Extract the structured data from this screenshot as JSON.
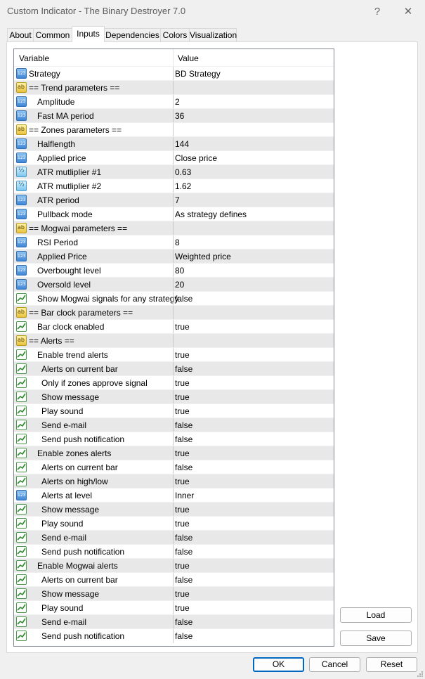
{
  "window": {
    "title": "Custom Indicator - The Binary Destroyer 7.0",
    "help_label": "?",
    "close_label": "✕"
  },
  "tabs": [
    {
      "label": "About"
    },
    {
      "label": "Common"
    },
    {
      "label": "Inputs",
      "active": true
    },
    {
      "label": "Dependencies"
    },
    {
      "label": "Colors"
    },
    {
      "label": "Visualization"
    }
  ],
  "table": {
    "headers": {
      "variable": "Variable",
      "value": "Value"
    },
    "rows": [
      {
        "icon": "number-icon",
        "indent": 0,
        "name": "Strategy",
        "value": "BD Strategy"
      },
      {
        "icon": "string-icon",
        "indent": 0,
        "name": "== Trend parameters ==",
        "value": ""
      },
      {
        "icon": "number-icon",
        "indent": 1,
        "name": "Amplitude",
        "value": "2"
      },
      {
        "icon": "number-icon",
        "indent": 1,
        "name": "Fast MA period",
        "value": "36"
      },
      {
        "icon": "string-icon",
        "indent": 0,
        "name": "== Zones parameters ==",
        "value": ""
      },
      {
        "icon": "number-icon",
        "indent": 1,
        "name": "Halflength",
        "value": "144"
      },
      {
        "icon": "number-icon",
        "indent": 1,
        "name": "Applied price",
        "value": "Close price"
      },
      {
        "icon": "double-icon",
        "indent": 1,
        "name": "ATR mutliplier #1",
        "value": "0.63"
      },
      {
        "icon": "double-icon",
        "indent": 1,
        "name": "ATR mutliplier #2",
        "value": "1.62"
      },
      {
        "icon": "number-icon",
        "indent": 1,
        "name": "ATR period",
        "value": "7"
      },
      {
        "icon": "number-icon",
        "indent": 1,
        "name": "Pullback mode",
        "value": "As strategy defines"
      },
      {
        "icon": "string-icon",
        "indent": 0,
        "name": "== Mogwai parameters ==",
        "value": ""
      },
      {
        "icon": "number-icon",
        "indent": 1,
        "name": "RSI Period",
        "value": "8"
      },
      {
        "icon": "number-icon",
        "indent": 1,
        "name": "Applied Price",
        "value": "Weighted price"
      },
      {
        "icon": "number-icon",
        "indent": 1,
        "name": "Overbought level",
        "value": "80"
      },
      {
        "icon": "number-icon",
        "indent": 1,
        "name": "Oversold level",
        "value": "20"
      },
      {
        "icon": "bool-icon",
        "indent": 1,
        "name": "Show Mogwai signals for any strategy",
        "value": "false"
      },
      {
        "icon": "string-icon",
        "indent": 0,
        "name": "== Bar clock parameters ==",
        "value": ""
      },
      {
        "icon": "bool-icon",
        "indent": 1,
        "name": "Bar clock enabled",
        "value": "true"
      },
      {
        "icon": "string-icon",
        "indent": 0,
        "name": "== Alerts ==",
        "value": ""
      },
      {
        "icon": "bool-icon",
        "indent": 1,
        "name": "Enable trend alerts",
        "value": "true"
      },
      {
        "icon": "bool-icon",
        "indent": 2,
        "name": "Alerts on current bar",
        "value": "false"
      },
      {
        "icon": "bool-icon",
        "indent": 2,
        "name": "Only if zones approve signal",
        "value": "true"
      },
      {
        "icon": "bool-icon",
        "indent": 2,
        "name": "Show message",
        "value": "true"
      },
      {
        "icon": "bool-icon",
        "indent": 2,
        "name": "Play sound",
        "value": "true"
      },
      {
        "icon": "bool-icon",
        "indent": 2,
        "name": "Send e-mail",
        "value": "false"
      },
      {
        "icon": "bool-icon",
        "indent": 2,
        "name": "Send push notification",
        "value": "false"
      },
      {
        "icon": "bool-icon",
        "indent": 1,
        "name": "Enable zones alerts",
        "value": "true"
      },
      {
        "icon": "bool-icon",
        "indent": 2,
        "name": "Alerts on current bar",
        "value": "false"
      },
      {
        "icon": "bool-icon",
        "indent": 2,
        "name": "Alerts on high/low",
        "value": "true"
      },
      {
        "icon": "number-icon",
        "indent": 2,
        "name": "Alerts at level",
        "value": "Inner"
      },
      {
        "icon": "bool-icon",
        "indent": 2,
        "name": "Show message",
        "value": "true"
      },
      {
        "icon": "bool-icon",
        "indent": 2,
        "name": "Play sound",
        "value": "true"
      },
      {
        "icon": "bool-icon",
        "indent": 2,
        "name": "Send e-mail",
        "value": "false"
      },
      {
        "icon": "bool-icon",
        "indent": 2,
        "name": "Send push notification",
        "value": "false"
      },
      {
        "icon": "bool-icon",
        "indent": 1,
        "name": "Enable Mogwai alerts",
        "value": "true"
      },
      {
        "icon": "bool-icon",
        "indent": 2,
        "name": "Alerts on current bar",
        "value": "false"
      },
      {
        "icon": "bool-icon",
        "indent": 2,
        "name": "Show message",
        "value": "true"
      },
      {
        "icon": "bool-icon",
        "indent": 2,
        "name": "Play sound",
        "value": "true"
      },
      {
        "icon": "bool-icon",
        "indent": 2,
        "name": "Send e-mail",
        "value": "false"
      },
      {
        "icon": "bool-icon",
        "indent": 2,
        "name": "Send push notification",
        "value": "false"
      }
    ]
  },
  "side_buttons": {
    "load_label": "Load",
    "save_label": "Save"
  },
  "footer": {
    "ok_label": "OK",
    "cancel_label": "Cancel",
    "reset_label": "Reset"
  }
}
